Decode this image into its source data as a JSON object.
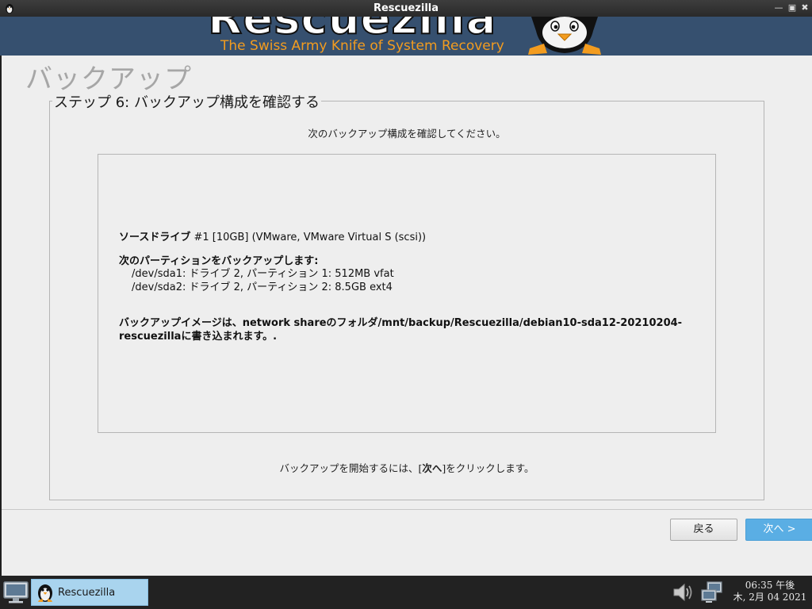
{
  "window": {
    "title": "Rescuezilla",
    "controls": [
      "minimize-icon",
      "maximize-icon",
      "close-icon"
    ]
  },
  "banner": {
    "brand": "Rescuezilla",
    "tagline": "The Swiss Army Knife of System Recovery"
  },
  "page": {
    "heading": "バックアップ",
    "step_title": "ステップ 6: バックアップ構成を確認する",
    "subtitle": "次のバックアップ構成を確認してください。",
    "summary": {
      "source_label": "ソースドライブ",
      "source_value": " #1 [10GB] (VMware, VMware Virtual S (scsi))",
      "partitions_label": "次のパーティションをバックアップします:",
      "partitions": [
        "/dev/sda1: ドライブ 2, パーティション 1: 512MB vfat",
        "/dev/sda2: ドライブ 2, パーティション 2: 8.5GB ext4"
      ],
      "destination_line1": "バックアップイメージは、network shareのフォルダ/mnt/backup/Rescuezilla/debian10-sda12-20210204-",
      "destination_line2": "rescuezillaに書き込まれます。."
    },
    "instruction_before": "バックアップを開始するには、[",
    "instruction_bold": "次へ",
    "instruction_after": "]をクリックします。",
    "back_button": "戻る",
    "next_button": "次へ >"
  },
  "taskbar": {
    "task_label": "Rescuezilla",
    "clock_time": "06:35 午後",
    "clock_date": "木, 2月 04 2021"
  },
  "colors": {
    "banner_bg": "#36506f",
    "tagline": "#f39c1f",
    "next_button": "#5aaee4",
    "task_active": "#a9d4ee",
    "taskbar_bg": "#222222"
  }
}
